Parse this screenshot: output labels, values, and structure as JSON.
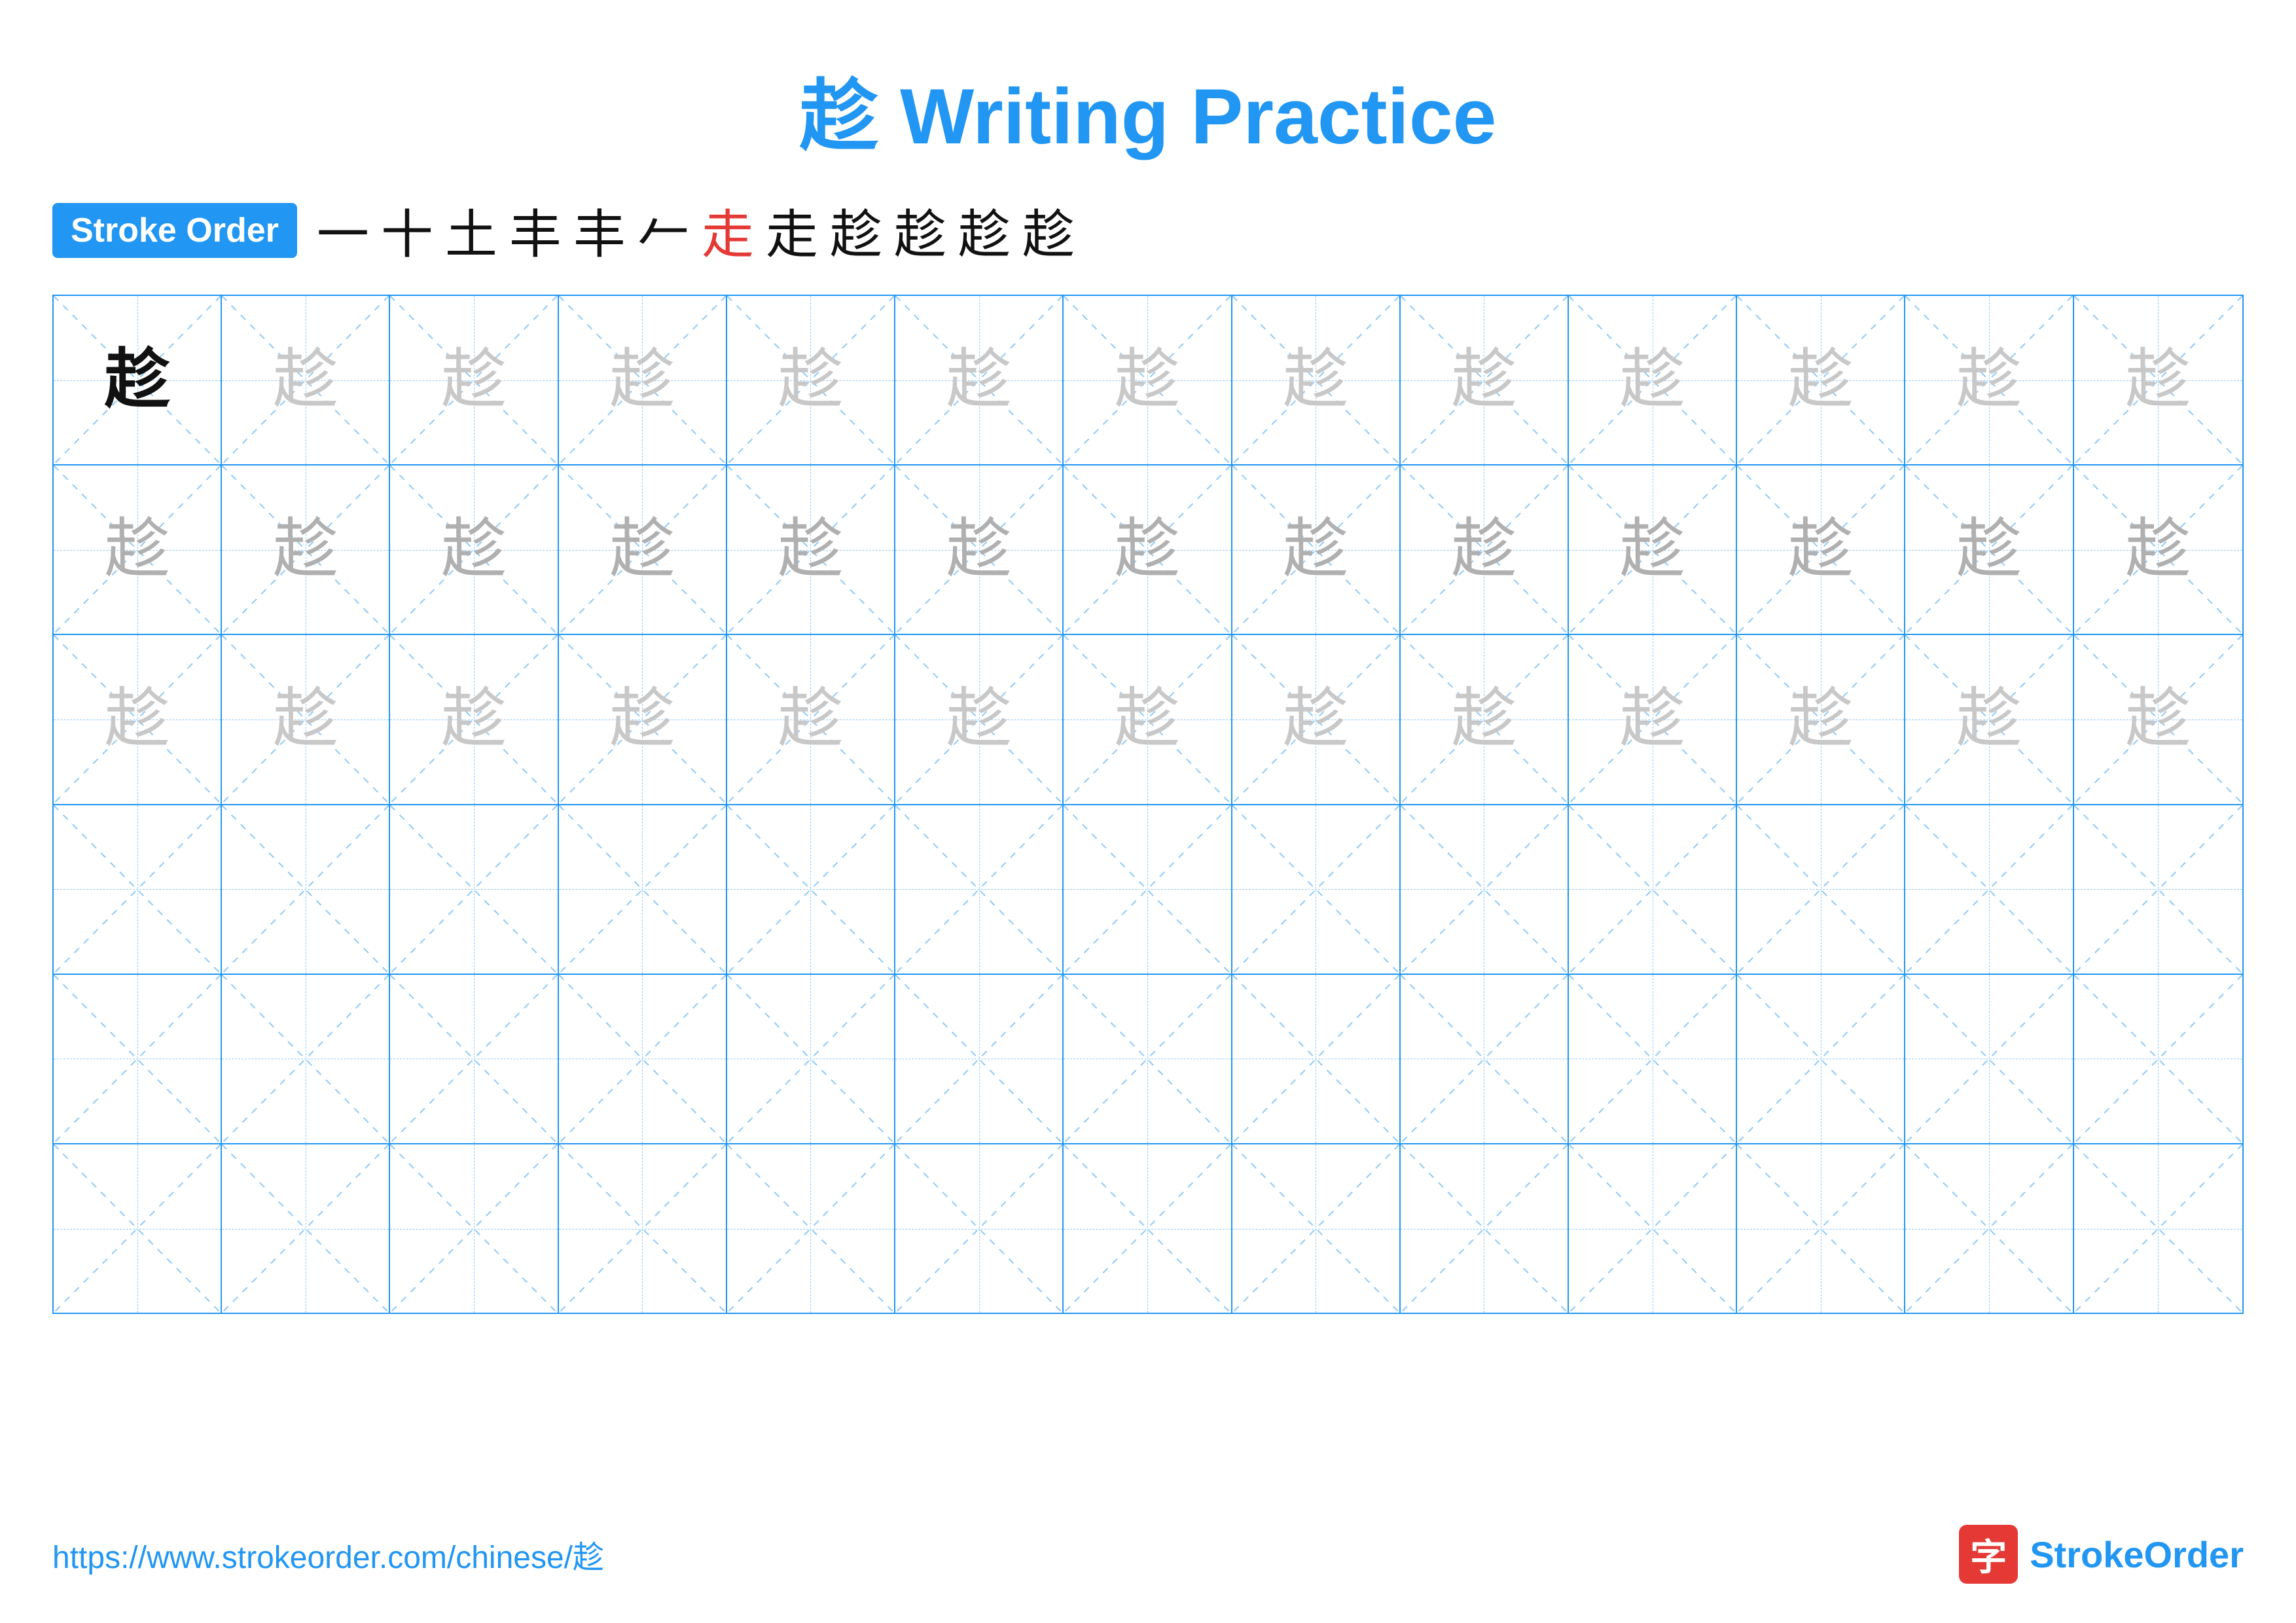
{
  "title": {
    "char": "趁",
    "text": " Writing Practice"
  },
  "stroke_order": {
    "badge": "Stroke Order",
    "strokes": [
      "一",
      "十",
      "土",
      "丰",
      "丰",
      "𠂉",
      "走",
      "走",
      "趁",
      "趁",
      "趁",
      "趁"
    ],
    "red_index": 6
  },
  "grid": {
    "rows": 6,
    "cols": 13,
    "char": "趁",
    "row_styles": [
      "dark",
      "light1",
      "light2",
      "empty",
      "empty",
      "empty"
    ],
    "first_cell_dark": true
  },
  "footer": {
    "url": "https://www.strokeorder.com/chinese/趁",
    "logo_char": "字",
    "logo_name": "StrokeOrder",
    "logo_name_colored": "Stroke",
    "logo_name_plain": "Order"
  }
}
